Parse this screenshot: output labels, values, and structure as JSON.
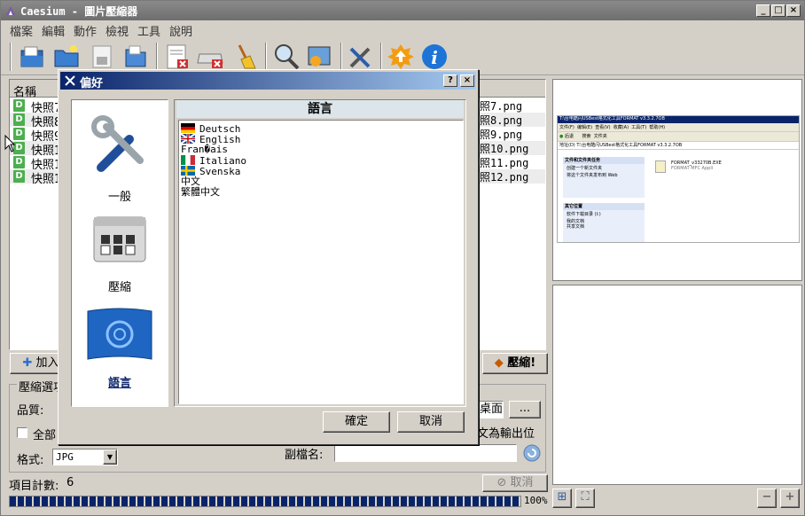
{
  "window": {
    "title": "Caesium - 圖片壓縮器",
    "minimize": "_",
    "maximize": "□",
    "close": "×"
  },
  "menu": [
    "檔案",
    "編輯",
    "動作",
    "檢視",
    "工具",
    "說明"
  ],
  "toolbar_icons": [
    "open-file-icon",
    "open-folder-icon",
    "save-list-icon",
    "open-list-icon",
    "remove-item-icon",
    "clear-list-icon",
    "sweep-icon",
    "search-icon",
    "preview-icon",
    "settings-icon",
    "update-icon",
    "about-icon"
  ],
  "list": {
    "header": "名稱",
    "rows": [
      {
        "left": "快照7",
        "right": "照7.png"
      },
      {
        "left": "快照8",
        "right": "照8.png"
      },
      {
        "left": "快照9",
        "right": "照9.png"
      },
      {
        "left": "快照1",
        "right": "照10.png"
      },
      {
        "left": "快照1",
        "right": "照11.png"
      },
      {
        "left": "快照1",
        "right": "照12.png"
      }
    ],
    "row_icon_letter": "D"
  },
  "buttons": {
    "add": "加入",
    "compress": "壓縮!",
    "browse": "...",
    "cancel": "取消"
  },
  "options": {
    "group_title": "壓縮選項",
    "quality_label": "品質:",
    "all_label": "全部",
    "format_label": "格式:",
    "format_value": "JPG",
    "output_folder": "桌面",
    "same_as_output": "文為輸出位置",
    "suffix_label": "副檔名:",
    "suffix_value": ""
  },
  "status": {
    "item_count_label": "項目計數:",
    "item_count": "6",
    "progress_text": "100%",
    "progress": 1.0
  },
  "preview": {
    "window_title": "T:\\台电酷闪USBest格式化工具FORMAT v3.3.2.7OB",
    "menu": [
      "文件(F)",
      "编辑(E)",
      "查看(V)",
      "收藏(A)",
      "工具(T)",
      "帮助(H)"
    ],
    "nav": [
      "后退",
      "搜索",
      "文件夹"
    ],
    "address_label": "地址(D)",
    "address": "T:\\台电酷闪USBest格式化工具FORMAT v3.3.2.7OB",
    "task_title": "文件和文件夹任务",
    "tasks": [
      "创建一个新文件夹",
      "将这个文件夹发布到 Web"
    ],
    "other_title": "其它位置",
    "others": [
      "软件下载目录 (I:)",
      "我的文档",
      "共享文档"
    ],
    "file_name": "FORMAT_v33270B.EXE",
    "file_desc": "FORMAT MFC Appli"
  },
  "dialog": {
    "title": "偏好",
    "help": "?",
    "close": "×",
    "categories": [
      "一般",
      "壓縮",
      "語言"
    ],
    "selected_category": "語言",
    "lang_header": "語言",
    "languages": [
      {
        "name": "Deutsch",
        "flag": "de"
      },
      {
        "name": "English",
        "flag": "gb"
      },
      {
        "name": "Fran�ais",
        "flag": "none"
      },
      {
        "name": "Italiano",
        "flag": "it"
      },
      {
        "name": "Svenska",
        "flag": "se"
      },
      {
        "name": "中文",
        "flag": "none"
      },
      {
        "name": "繁體中文",
        "flag": "none"
      }
    ],
    "ok": "確定",
    "cancel": "取消"
  },
  "colors": {
    "accent": "#0a246a",
    "face": "#d4d0c8",
    "row_icon": "#4caf50"
  }
}
